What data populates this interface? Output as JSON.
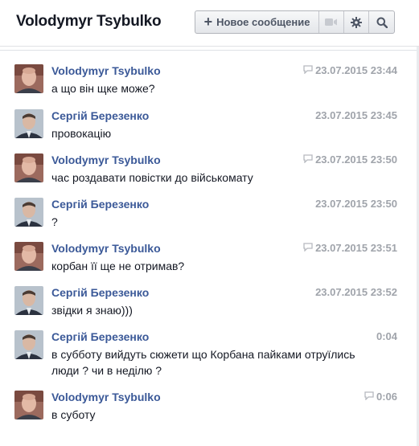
{
  "header": {
    "title": "Volodymyr Tsybulko",
    "new_message_label": "Новое сообщение",
    "icons": [
      "plus-icon",
      "video-icon",
      "gear-icon",
      "search-icon"
    ]
  },
  "messages": [
    {
      "author": "Volodymyr Tsybulko",
      "time": "23.07.2015 23:44",
      "text": "а що він щке може?",
      "reply_icon": true
    },
    {
      "author": "Сергій Березенко",
      "time": "23.07.2015 23:45",
      "text": "провокацію",
      "reply_icon": false
    },
    {
      "author": "Volodymyr Tsybulko",
      "time": "23.07.2015 23:50",
      "text": "час роздавати повістки до військомату",
      "reply_icon": true
    },
    {
      "author": "Сергій Березенко",
      "time": "23.07.2015 23:50",
      "text": "?",
      "reply_icon": false
    },
    {
      "author": "Volodymyr Tsybulko",
      "time": "23.07.2015 23:51",
      "text": "корбан її ще не отримав?",
      "reply_icon": true
    },
    {
      "author": "Сергій Березенко",
      "time": "23.07.2015 23:52",
      "text": "звідки я знаю)))",
      "reply_icon": false
    },
    {
      "author": "Сергій Березенко",
      "time": "0:04",
      "text": "в субботу вийдуть сюжети що Корбана пайками отруїлись люди ? чи в неділю ?",
      "reply_icon": false
    },
    {
      "author": "Volodymyr Tsybulko",
      "time": "0:06",
      "text": "в суботу",
      "reply_icon": true
    }
  ]
}
